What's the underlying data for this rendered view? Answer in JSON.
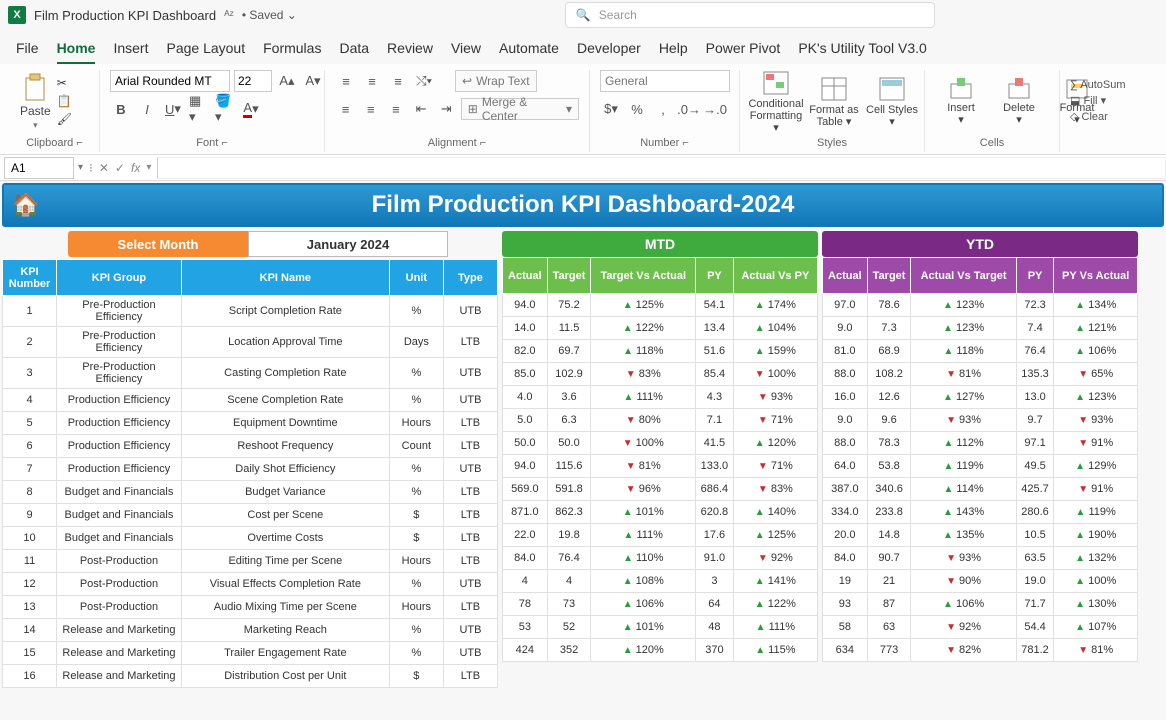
{
  "app": {
    "title": "Film Production KPI Dashboard",
    "saved": "Saved"
  },
  "search": {
    "placeholder": "Search"
  },
  "menu": [
    "File",
    "Home",
    "Insert",
    "Page Layout",
    "Formulas",
    "Data",
    "Review",
    "View",
    "Automate",
    "Developer",
    "Help",
    "Power Pivot",
    "PK's Utility Tool V3.0"
  ],
  "ribbon": {
    "paste": "Paste",
    "font_name": "Arial Rounded MT",
    "font_size": "22",
    "wrap": "Wrap Text",
    "merge": "Merge & Center",
    "numfmt": "General",
    "cond": "Conditional Formatting",
    "fat": "Format as Table",
    "cellstyles": "Cell Styles",
    "insert": "Insert",
    "delete": "Delete",
    "format": "Format",
    "autosum": "AutoSum",
    "fill": "Fill",
    "clear": "Clear",
    "groups": {
      "clipboard": "Clipboard",
      "font": "Font",
      "alignment": "Alignment",
      "number": "Number",
      "styles": "Styles",
      "cells": "Cells"
    }
  },
  "cellref": "A1",
  "dash": {
    "title": "Film Production KPI Dashboard-2024",
    "select_label": "Select Month",
    "select_value": "January 2024",
    "mtd": "MTD",
    "ytd": "YTD",
    "left_headers": [
      "KPI Number",
      "KPI Group",
      "KPI Name",
      "Unit",
      "Type"
    ],
    "mtd_headers": [
      "Actual",
      "Target",
      "Target Vs Actual",
      "PY",
      "Actual Vs PY"
    ],
    "ytd_headers": [
      "Actual",
      "Target",
      "Actual Vs Target",
      "PY",
      "PY Vs Actual"
    ],
    "rows": [
      {
        "n": "1",
        "g": "Pre-Production Efficiency",
        "name": "Script Completion Rate",
        "unit": "%",
        "type": "UTB",
        "mtd": [
          "94.0",
          "75.2",
          "u",
          "125%",
          "54.1",
          "u",
          "174%"
        ],
        "ytd": [
          "97.0",
          "78.6",
          "u",
          "123%",
          "72.3",
          "u",
          "134%"
        ]
      },
      {
        "n": "2",
        "g": "Pre-Production Efficiency",
        "name": "Location Approval Time",
        "unit": "Days",
        "type": "LTB",
        "mtd": [
          "14.0",
          "11.5",
          "u",
          "122%",
          "13.4",
          "u",
          "104%"
        ],
        "ytd": [
          "9.0",
          "7.3",
          "u",
          "123%",
          "7.4",
          "u",
          "121%"
        ]
      },
      {
        "n": "3",
        "g": "Pre-Production Efficiency",
        "name": "Casting Completion Rate",
        "unit": "%",
        "type": "UTB",
        "mtd": [
          "82.0",
          "69.7",
          "u",
          "118%",
          "51.6",
          "u",
          "159%"
        ],
        "ytd": [
          "81.0",
          "68.9",
          "u",
          "118%",
          "76.4",
          "u",
          "106%"
        ]
      },
      {
        "n": "4",
        "g": "Production Efficiency",
        "name": "Scene Completion Rate",
        "unit": "%",
        "type": "UTB",
        "mtd": [
          "85.0",
          "102.9",
          "d",
          "83%",
          "85.4",
          "d",
          "100%"
        ],
        "ytd": [
          "88.0",
          "108.2",
          "d",
          "81%",
          "135.3",
          "d",
          "65%"
        ]
      },
      {
        "n": "5",
        "g": "Production Efficiency",
        "name": "Equipment Downtime",
        "unit": "Hours",
        "type": "LTB",
        "mtd": [
          "4.0",
          "3.6",
          "u",
          "111%",
          "4.3",
          "d",
          "93%"
        ],
        "ytd": [
          "16.0",
          "12.6",
          "u",
          "127%",
          "13.0",
          "u",
          "123%"
        ]
      },
      {
        "n": "6",
        "g": "Production Efficiency",
        "name": "Reshoot Frequency",
        "unit": "Count",
        "type": "LTB",
        "mtd": [
          "5.0",
          "6.3",
          "d",
          "80%",
          "7.1",
          "d",
          "71%"
        ],
        "ytd": [
          "9.0",
          "9.6",
          "d",
          "93%",
          "9.7",
          "d",
          "93%"
        ]
      },
      {
        "n": "7",
        "g": "Production Efficiency",
        "name": "Daily Shot Efficiency",
        "unit": "%",
        "type": "UTB",
        "mtd": [
          "50.0",
          "50.0",
          "d",
          "100%",
          "41.5",
          "u",
          "120%"
        ],
        "ytd": [
          "88.0",
          "78.3",
          "u",
          "112%",
          "97.1",
          "d",
          "91%"
        ]
      },
      {
        "n": "8",
        "g": "Budget and Financials",
        "name": "Budget Variance",
        "unit": "%",
        "type": "LTB",
        "mtd": [
          "94.0",
          "115.6",
          "d",
          "81%",
          "133.0",
          "d",
          "71%"
        ],
        "ytd": [
          "64.0",
          "53.8",
          "u",
          "119%",
          "49.5",
          "u",
          "129%"
        ]
      },
      {
        "n": "9",
        "g": "Budget and Financials",
        "name": "Cost per Scene",
        "unit": "$",
        "type": "LTB",
        "mtd": [
          "569.0",
          "591.8",
          "d",
          "96%",
          "686.4",
          "d",
          "83%"
        ],
        "ytd": [
          "387.0",
          "340.6",
          "u",
          "114%",
          "425.7",
          "d",
          "91%"
        ]
      },
      {
        "n": "10",
        "g": "Budget and Financials",
        "name": "Overtime Costs",
        "unit": "$",
        "type": "LTB",
        "mtd": [
          "871.0",
          "862.3",
          "u",
          "101%",
          "620.8",
          "u",
          "140%"
        ],
        "ytd": [
          "334.0",
          "233.8",
          "u",
          "143%",
          "280.6",
          "u",
          "119%"
        ]
      },
      {
        "n": "11",
        "g": "Post-Production",
        "name": "Editing Time per Scene",
        "unit": "Hours",
        "type": "LTB",
        "mtd": [
          "22.0",
          "19.8",
          "u",
          "111%",
          "17.6",
          "u",
          "125%"
        ],
        "ytd": [
          "20.0",
          "14.8",
          "u",
          "135%",
          "10.5",
          "u",
          "190%"
        ]
      },
      {
        "n": "12",
        "g": "Post-Production",
        "name": "Visual Effects Completion Rate",
        "unit": "%",
        "type": "UTB",
        "mtd": [
          "84.0",
          "76.4",
          "u",
          "110%",
          "91.0",
          "d",
          "92%"
        ],
        "ytd": [
          "84.0",
          "90.7",
          "d",
          "93%",
          "63.5",
          "u",
          "132%"
        ]
      },
      {
        "n": "13",
        "g": "Post-Production",
        "name": "Audio Mixing Time per Scene",
        "unit": "Hours",
        "type": "LTB",
        "mtd": [
          "4",
          "4",
          "u",
          "108%",
          "3",
          "u",
          "141%"
        ],
        "ytd": [
          "19",
          "21",
          "d",
          "90%",
          "19.0",
          "u",
          "100%"
        ]
      },
      {
        "n": "14",
        "g": "Release and Marketing",
        "name": "Marketing Reach",
        "unit": "%",
        "type": "UTB",
        "mtd": [
          "78",
          "73",
          "u",
          "106%",
          "64",
          "u",
          "122%"
        ],
        "ytd": [
          "93",
          "87",
          "u",
          "106%",
          "71.7",
          "u",
          "130%"
        ]
      },
      {
        "n": "15",
        "g": "Release and Marketing",
        "name": "Trailer Engagement Rate",
        "unit": "%",
        "type": "UTB",
        "mtd": [
          "53",
          "52",
          "u",
          "101%",
          "48",
          "u",
          "111%"
        ],
        "ytd": [
          "58",
          "63",
          "d",
          "92%",
          "54.4",
          "u",
          "107%"
        ]
      },
      {
        "n": "16",
        "g": "Release and Marketing",
        "name": "Distribution Cost per Unit",
        "unit": "$",
        "type": "LTB",
        "mtd": [
          "424",
          "352",
          "u",
          "120%",
          "370",
          "u",
          "115%"
        ],
        "ytd": [
          "634",
          "773",
          "d",
          "82%",
          "781.2",
          "d",
          "81%"
        ]
      }
    ]
  }
}
